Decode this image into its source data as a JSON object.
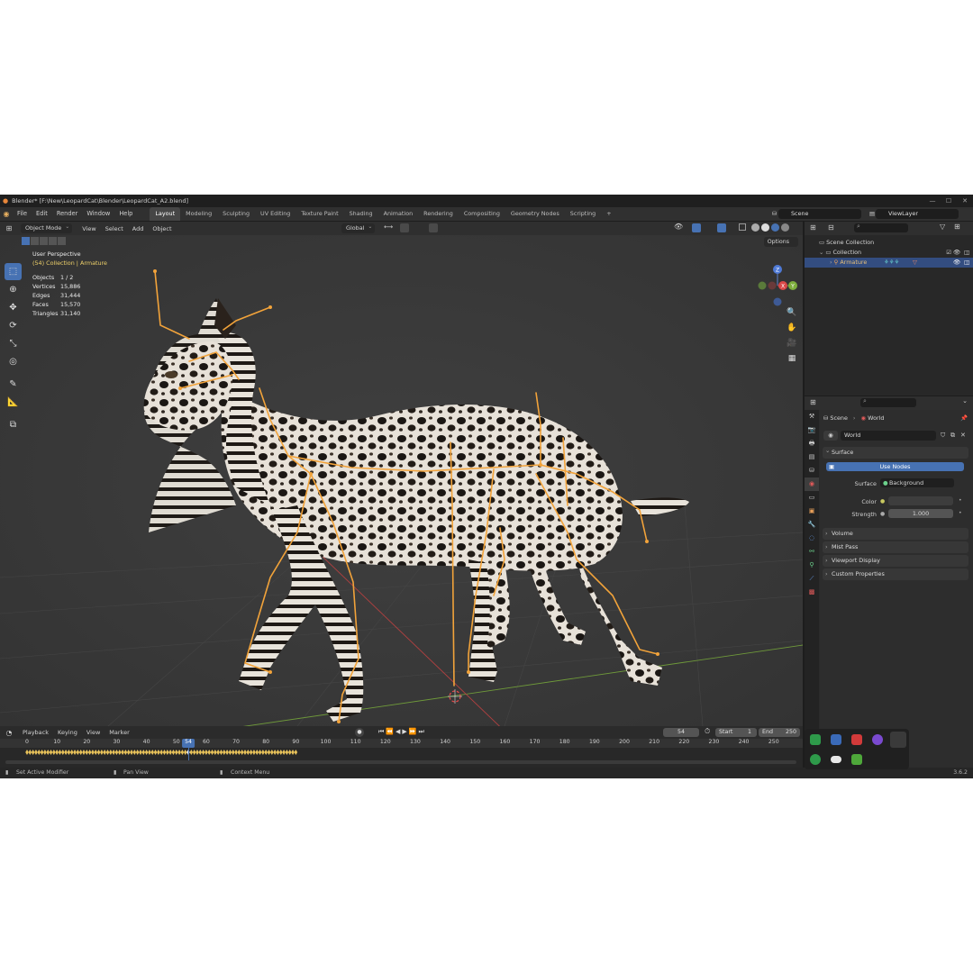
{
  "window": {
    "title": "Blender* [F:\\New\\LeopardCat\\Blender\\LeopardCat_A2.blend]",
    "controls": [
      "—",
      "☐",
      "✕"
    ]
  },
  "topbar": {
    "menus": [
      "File",
      "Edit",
      "Render",
      "Window",
      "Help"
    ],
    "workspaces": [
      "Layout",
      "Modeling",
      "Sculpting",
      "UV Editing",
      "Texture Paint",
      "Shading",
      "Animation",
      "Rendering",
      "Compositing",
      "Geometry Nodes",
      "Scripting"
    ],
    "active_workspace": "Layout",
    "add_tab": "+",
    "scene": "Scene",
    "view_layer": "ViewLayer"
  },
  "viewport": {
    "mode": "Object Mode",
    "menus": [
      "View",
      "Select",
      "Add",
      "Object"
    ],
    "orientation": "Global",
    "options_label": "Options",
    "overlay_title": "User Perspective",
    "overlay_subtitle": "(54) Collection | Armature",
    "stats": [
      {
        "label": "Objects",
        "value": "1 / 2"
      },
      {
        "label": "Vertices",
        "value": "15,886"
      },
      {
        "label": "Edges",
        "value": "31,444"
      },
      {
        "label": "Faces",
        "value": "15,570"
      },
      {
        "label": "Triangles",
        "value": "31,140"
      }
    ],
    "gizmo_axes": {
      "z": "Z",
      "x": "X",
      "y": "Y"
    },
    "colors": {
      "background": "#3b3b3b",
      "bone": "#f2a33a",
      "x_axis": "#c04040",
      "y_axis": "#6f9a3a",
      "active": "#4772b3"
    }
  },
  "tools": [
    "select-box-icon",
    "cursor-icon",
    "move-icon",
    "rotate-icon",
    "scale-icon",
    "transform-icon",
    "annotate-icon",
    "measure-icon",
    "add-cube-icon"
  ],
  "timeline": {
    "menus": [
      "Playback",
      "Keying",
      "View",
      "Marker"
    ],
    "current_frame": "54",
    "start_label": "Start",
    "start": "1",
    "end_label": "End",
    "end": "250",
    "ticks": [
      "0",
      "10",
      "20",
      "30",
      "40",
      "50",
      "60",
      "70",
      "80",
      "90",
      "100",
      "110",
      "120",
      "130",
      "140",
      "150",
      "160",
      "170",
      "180",
      "190",
      "200",
      "210",
      "220",
      "230",
      "240",
      "250"
    ],
    "keyframe_range": [
      0,
      90
    ]
  },
  "statusbar": {
    "left": "Set Active Modifier",
    "middle": "Pan View",
    "right": "Context Menu",
    "version": "3.6.2"
  },
  "outliner": {
    "items": [
      {
        "label": "Scene Collection",
        "depth": 0
      },
      {
        "label": "Collection",
        "depth": 1
      },
      {
        "label": "Armature",
        "depth": 2,
        "selected": true
      }
    ]
  },
  "properties": {
    "breadcrumb": [
      "Scene",
      "World"
    ],
    "world_name": "World",
    "surface_panel": "Surface",
    "use_nodes": "Use Nodes",
    "surface_label": "Surface",
    "surface_value": "Background",
    "color_label": "Color",
    "strength_label": "Strength",
    "strength_value": "1.000",
    "panels": [
      "Volume",
      "Mist Pass",
      "Viewport Display",
      "Custom Properties"
    ]
  }
}
